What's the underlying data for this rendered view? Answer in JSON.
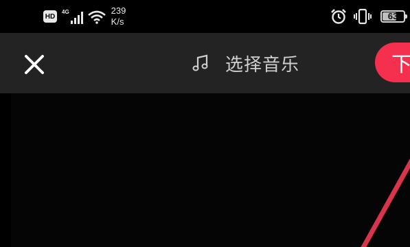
{
  "status_bar": {
    "hd_label": "HD",
    "network_label": "4G",
    "speed_value": "239",
    "speed_unit": "K/s",
    "battery_level": "63",
    "icons": [
      "hd-icon",
      "signal-icon",
      "wifi-icon",
      "alarm-icon",
      "vibrate-icon",
      "battery-icon"
    ]
  },
  "toolbar": {
    "music_label": "选择音乐",
    "next_label": "下",
    "accent_color": "#f5304f"
  }
}
